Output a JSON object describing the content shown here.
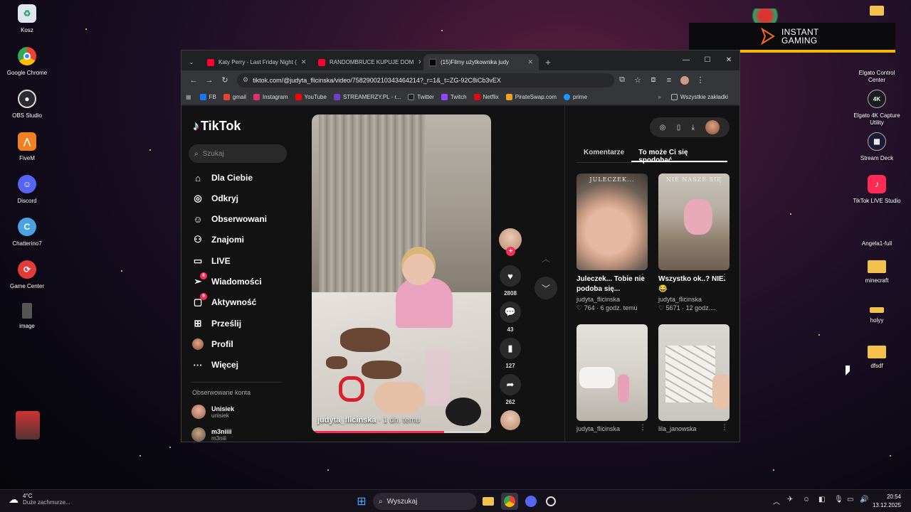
{
  "desktop": {
    "left_icons": [
      {
        "label": "Kosz",
        "icon": "recycle-bin-icon"
      },
      {
        "label": "Google Chrome",
        "icon": "chrome-icon"
      },
      {
        "label": "OBS Studio",
        "icon": "obs-icon"
      },
      {
        "label": "FiveM",
        "icon": "fivem-icon"
      },
      {
        "label": "Discord",
        "icon": "discord-icon"
      },
      {
        "label": "Chatterino7",
        "icon": "chatterino-icon"
      },
      {
        "label": "Game Center",
        "icon": "game-center-icon"
      },
      {
        "label": "image",
        "icon": "image-file-icon"
      }
    ],
    "right_icons": [
      {
        "label": "Elgato Control Center",
        "icon": "elgato-icon"
      },
      {
        "label": "Elgato 4K Capture Utility",
        "icon": "elgato-4k-icon"
      },
      {
        "label": "Stream Deck",
        "icon": "stream-deck-icon"
      },
      {
        "label": "TikTok LIVE Studio",
        "icon": "tiktok-live-icon"
      },
      {
        "label": "Angela1-full",
        "icon": "file-icon"
      },
      {
        "label": "minecraft",
        "icon": "folder-icon"
      },
      {
        "label": "holyy",
        "icon": "folder-icon"
      },
      {
        "label": "dfsdf",
        "icon": "folder-icon"
      }
    ],
    "banner": {
      "line1": "INSTANT",
      "line2": "GAMING"
    }
  },
  "browser": {
    "tabs": [
      {
        "title": "Katy Perry - Last Friday Night (",
        "favicon_color": "#ff0033"
      },
      {
        "title": "RANDOMBRUCE KUPUJE DOM",
        "favicon_color": "#ff0033"
      },
      {
        "title": "(15)Filmy użytkownika judy",
        "favicon_color": "#000000",
        "active": true
      }
    ],
    "url": "tiktok.com/@judyta_flicinska/video/7582900210343464214?_r=1&_t=ZG-92C8iCb3vEX",
    "bookmarks": [
      {
        "label": "FB",
        "color": "#1877f2"
      },
      {
        "label": "gmail",
        "color": "#ea4335"
      },
      {
        "label": "Instagram",
        "color": "#e1306c"
      },
      {
        "label": "YouTube",
        "color": "#ff0000"
      },
      {
        "label": "STREAMERZY.PL - r...",
        "color": "#6d3fd0"
      },
      {
        "label": "Twitter",
        "color": "#222222"
      },
      {
        "label": "Twitch",
        "color": "#9146ff"
      },
      {
        "label": "Netflix",
        "color": "#e50914"
      },
      {
        "label": "PirateSwap.com",
        "color": "#f0a020"
      },
      {
        "label": "prime",
        "color": "#1a98ff"
      }
    ],
    "all_bookmarks": "Wszystkie zakładki"
  },
  "tiktok": {
    "logo": "TikTok",
    "search_placeholder": "Szukaj",
    "nav": [
      {
        "label": "Dla Ciebie",
        "icon": "home-icon"
      },
      {
        "label": "Odkryj",
        "icon": "compass-icon"
      },
      {
        "label": "Obserwowani",
        "icon": "following-icon"
      },
      {
        "label": "Znajomi",
        "icon": "friends-icon"
      },
      {
        "label": "LIVE",
        "icon": "live-icon"
      },
      {
        "label": "Wiadomości",
        "icon": "messages-icon",
        "badge": "6"
      },
      {
        "label": "Aktywność",
        "icon": "activity-icon",
        "badge": "9"
      },
      {
        "label": "Prześlij",
        "icon": "upload-icon"
      },
      {
        "label": "Profil",
        "icon": "avatar-icon"
      },
      {
        "label": "Więcej",
        "icon": "more-icon"
      }
    ],
    "followed_title": "Obserwowane konta",
    "followed": [
      {
        "name": "Unisiek",
        "handle": "unisiek"
      },
      {
        "name": "m3niiii",
        "handle": "m3niii"
      }
    ],
    "video": {
      "author": "judyta_flicinska",
      "time": "· 1 dn. temu",
      "progress": 0.74
    },
    "actions": {
      "likes": "2808",
      "comments": "43",
      "saves": "127",
      "shares": "262"
    },
    "right_tabs": [
      "Komentarze",
      "To może Ci się spodobać"
    ],
    "cards": [
      {
        "title": "Juleczek... Tobie nie podoba się...",
        "user": "judyta_flicinska",
        "meta": "♡ 764 · 6 godz. temu",
        "overlay": "JULECZEK..."
      },
      {
        "title": "Wszystko ok..? NIE. 😂",
        "user": "judyta_flicinska",
        "meta": "♡ 5671 · 12 godz....",
        "overlay": "NIE NASZE SIĘ"
      },
      {
        "title": "",
        "user": "judyta_flicinska",
        "meta": "",
        "overlay": ""
      },
      {
        "title": "",
        "user": "lila_janowska",
        "meta": "",
        "overlay": ""
      }
    ]
  },
  "taskbar": {
    "weather_temp": "4°C",
    "weather_desc": "Duże zachmurze...",
    "search": "Wyszukaj",
    "time": "20:54",
    "date": "13.12.2025"
  }
}
